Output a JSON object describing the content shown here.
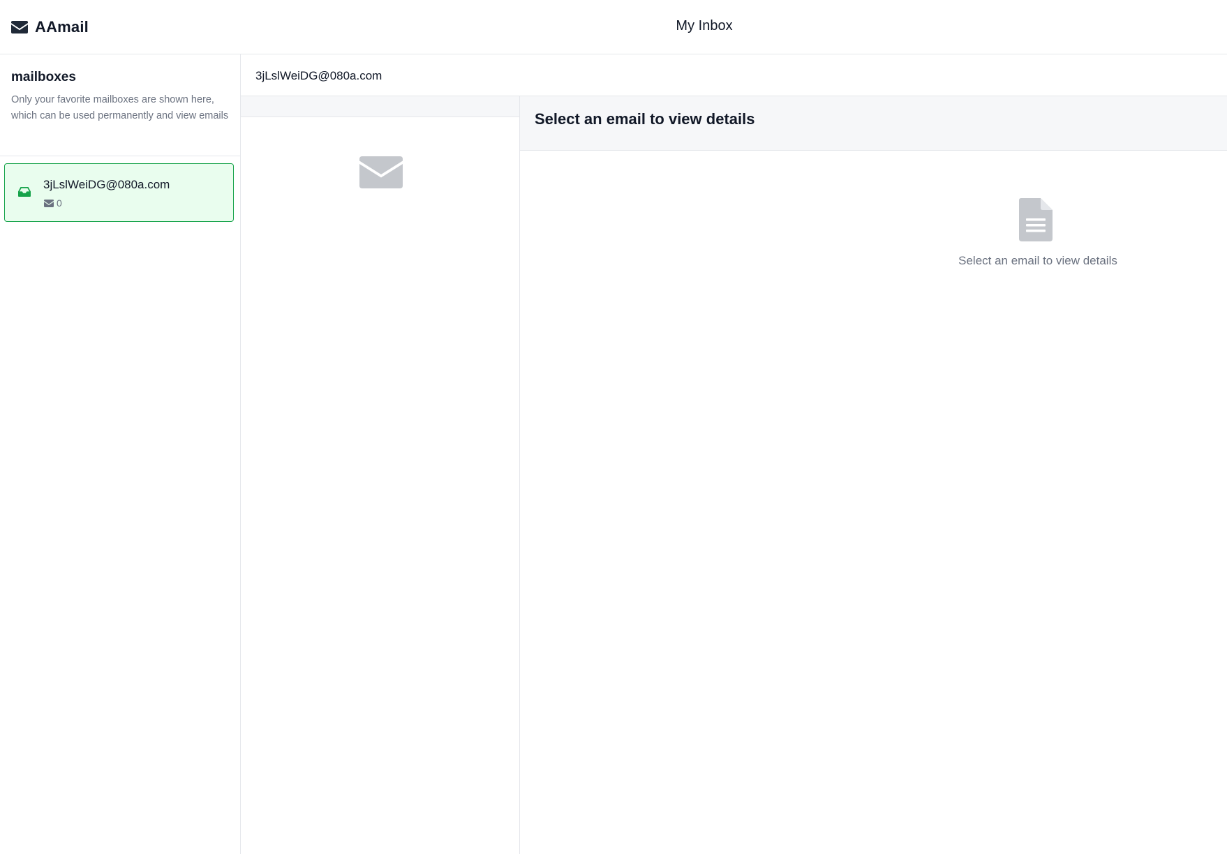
{
  "app": {
    "name": "AAmail",
    "page_title": "My Inbox",
    "brand_icon": "envelope-icon"
  },
  "sidebar": {
    "title": "mailboxes",
    "description": "Only your favorite mailboxes are shown here, which can be used permanently and view emails",
    "mailboxes": [
      {
        "address": "3jLslWeiDG@080a.com",
        "count": "0",
        "icon": "inbox-icon",
        "selected": true
      }
    ]
  },
  "mail_header": {
    "address": "3jLslWeiDG@080a.com"
  },
  "email_list": {
    "empty_icon": "envelope-icon"
  },
  "detail": {
    "title": "Select an email to view details",
    "empty_text": "Select an email to view details",
    "empty_icon": "document-icon"
  },
  "colors": {
    "selected_background": "#e9fdee",
    "selected_border": "#16a34a",
    "muted_text": "#6b7280",
    "icon_gray": "#c4c7cc"
  }
}
